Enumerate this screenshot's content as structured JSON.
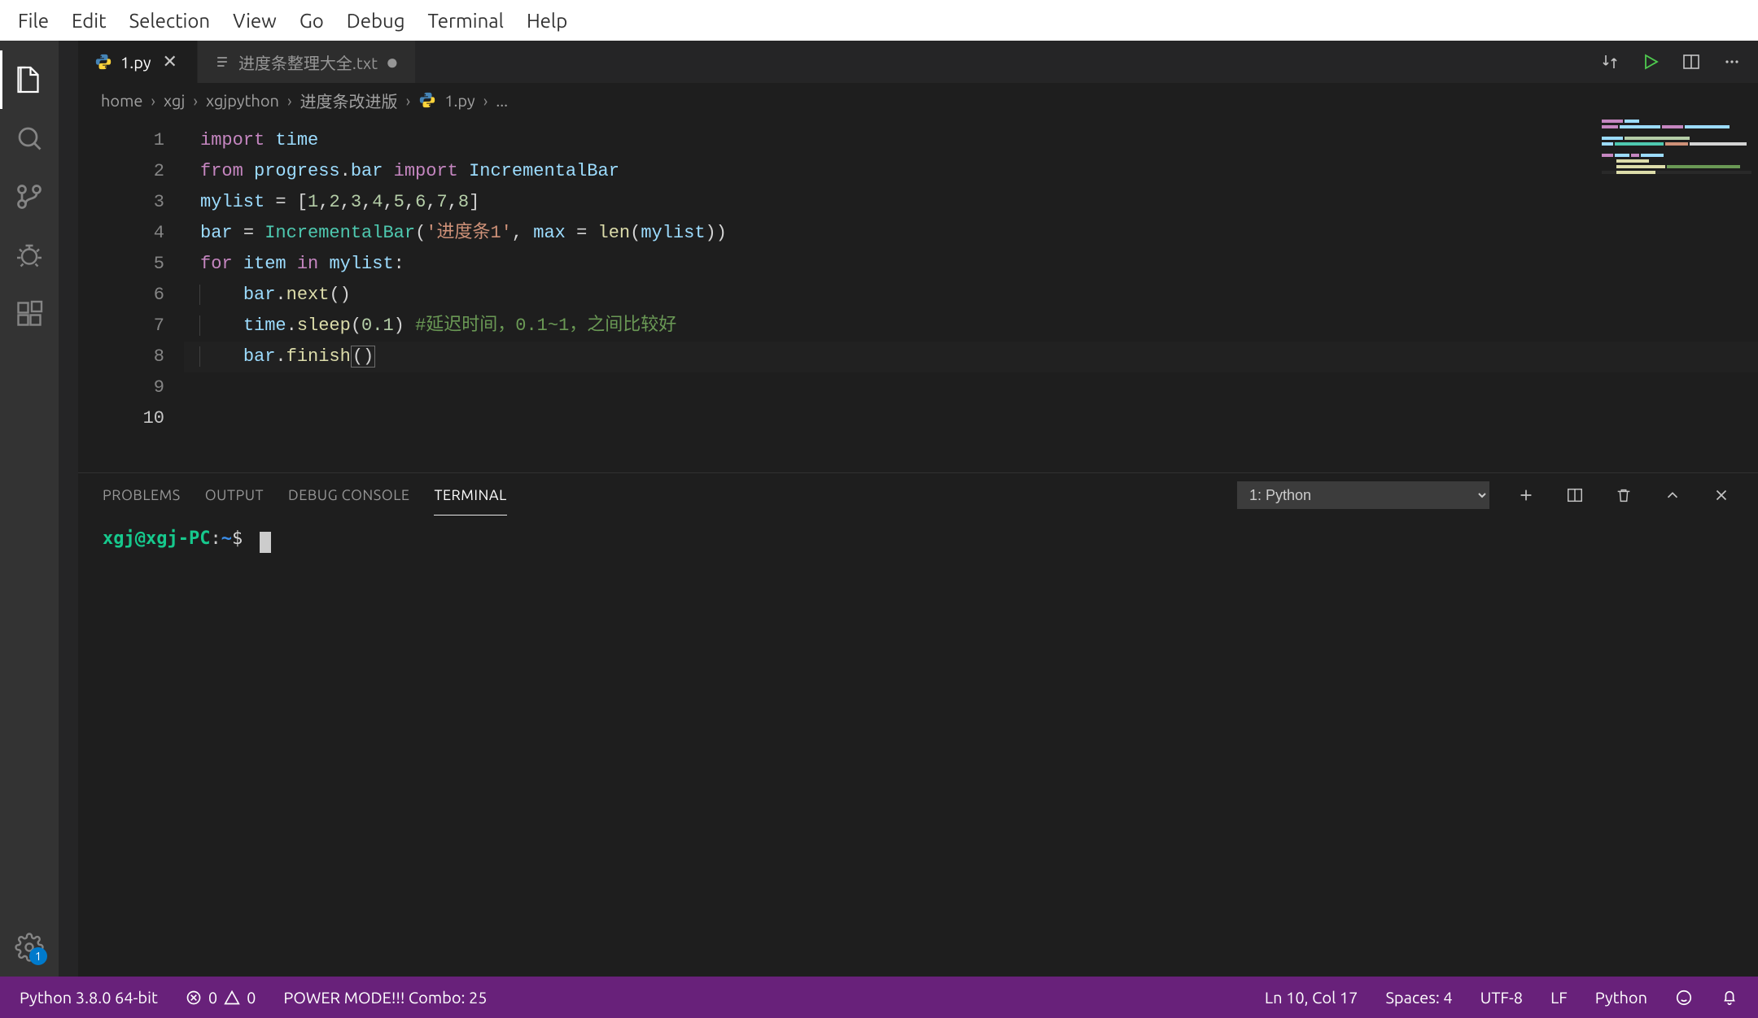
{
  "menubar": [
    "File",
    "Edit",
    "Selection",
    "View",
    "Go",
    "Debug",
    "Terminal",
    "Help"
  ],
  "activitybar": {
    "gear_badge": "1"
  },
  "tabs": [
    {
      "label": "1.py",
      "active": true,
      "icon": "python",
      "dirty": false
    },
    {
      "label": "进度条整理大全.txt",
      "active": false,
      "icon": "text",
      "dirty": true
    }
  ],
  "breadcrumbs": [
    "home",
    "xgj",
    "xgjpython",
    "进度条改进版",
    "1.py",
    "..."
  ],
  "editor": {
    "lines": [
      [
        {
          "t": "kw",
          "v": "import"
        },
        {
          "t": "pln",
          "v": " "
        },
        {
          "t": "id",
          "v": "time"
        }
      ],
      [
        {
          "t": "kw",
          "v": "from"
        },
        {
          "t": "pln",
          "v": " "
        },
        {
          "t": "id",
          "v": "progress"
        },
        {
          "t": "pln",
          "v": "."
        },
        {
          "t": "id",
          "v": "bar"
        },
        {
          "t": "pln",
          "v": " "
        },
        {
          "t": "kw",
          "v": "import"
        },
        {
          "t": "pln",
          "v": " "
        },
        {
          "t": "id",
          "v": "IncrementalBar"
        }
      ],
      [],
      [
        {
          "t": "id",
          "v": "mylist"
        },
        {
          "t": "pln",
          "v": " "
        },
        {
          "t": "pln",
          "v": "="
        },
        {
          "t": "pln",
          "v": " ["
        },
        {
          "t": "num",
          "v": "1"
        },
        {
          "t": "pln",
          "v": ","
        },
        {
          "t": "num",
          "v": "2"
        },
        {
          "t": "pln",
          "v": ","
        },
        {
          "t": "num",
          "v": "3"
        },
        {
          "t": "pln",
          "v": ","
        },
        {
          "t": "num",
          "v": "4"
        },
        {
          "t": "pln",
          "v": ","
        },
        {
          "t": "num",
          "v": "5"
        },
        {
          "t": "pln",
          "v": ","
        },
        {
          "t": "num",
          "v": "6"
        },
        {
          "t": "pln",
          "v": ","
        },
        {
          "t": "num",
          "v": "7"
        },
        {
          "t": "pln",
          "v": ","
        },
        {
          "t": "num",
          "v": "8"
        },
        {
          "t": "pln",
          "v": "]"
        }
      ],
      [
        {
          "t": "id",
          "v": "bar"
        },
        {
          "t": "pln",
          "v": " "
        },
        {
          "t": "pln",
          "v": "="
        },
        {
          "t": "pln",
          "v": " "
        },
        {
          "t": "cls",
          "v": "IncrementalBar"
        },
        {
          "t": "pln",
          "v": "("
        },
        {
          "t": "str",
          "v": "'进度条1'"
        },
        {
          "t": "pln",
          "v": ", "
        },
        {
          "t": "id",
          "v": "max"
        },
        {
          "t": "pln",
          "v": " "
        },
        {
          "t": "pln",
          "v": "="
        },
        {
          "t": "pln",
          "v": " "
        },
        {
          "t": "fn",
          "v": "len"
        },
        {
          "t": "pln",
          "v": "("
        },
        {
          "t": "id",
          "v": "mylist"
        },
        {
          "t": "pln",
          "v": "))"
        }
      ],
      [],
      [
        {
          "t": "kw",
          "v": "for"
        },
        {
          "t": "pln",
          "v": " "
        },
        {
          "t": "id",
          "v": "item"
        },
        {
          "t": "pln",
          "v": " "
        },
        {
          "t": "kw",
          "v": "in"
        },
        {
          "t": "pln",
          "v": " "
        },
        {
          "t": "id",
          "v": "mylist"
        },
        {
          "t": "pln",
          "v": ":"
        }
      ],
      [
        {
          "t": "indent",
          "v": "    "
        },
        {
          "t": "id",
          "v": "bar"
        },
        {
          "t": "pln",
          "v": "."
        },
        {
          "t": "fn",
          "v": "next"
        },
        {
          "t": "pln",
          "v": "()"
        }
      ],
      [
        {
          "t": "indent",
          "v": "    "
        },
        {
          "t": "id",
          "v": "time"
        },
        {
          "t": "pln",
          "v": "."
        },
        {
          "t": "fn",
          "v": "sleep"
        },
        {
          "t": "pln",
          "v": "("
        },
        {
          "t": "num",
          "v": "0.1"
        },
        {
          "t": "pln",
          "v": ") "
        },
        {
          "t": "cmt",
          "v": "#延迟时间，0.1~1，之间比较好"
        }
      ],
      [
        {
          "t": "indent",
          "v": "    "
        },
        {
          "t": "id",
          "v": "bar"
        },
        {
          "t": "pln",
          "v": "."
        },
        {
          "t": "fn",
          "v": "finish"
        },
        {
          "t": "box",
          "v": "()"
        }
      ]
    ],
    "current_line_index": 10
  },
  "panel": {
    "tabs": [
      "PROBLEMS",
      "OUTPUT",
      "DEBUG CONSOLE",
      "TERMINAL"
    ],
    "active_tab": "TERMINAL",
    "dropdown_selected": "1: Python",
    "terminal_prompt": {
      "user_host": "xgj@xgj-PC",
      "sep": ":",
      "path": "~",
      "symbol": "$"
    }
  },
  "statusbar": {
    "interpreter": "Python 3.8.0 64-bit",
    "errors": "0",
    "warnings": "0",
    "power_mode": "POWER MODE!!! Combo: 25",
    "cursor": "Ln 10, Col 17",
    "spaces": "Spaces: 4",
    "encoding": "UTF-8",
    "eol": "LF",
    "language": "Python"
  }
}
